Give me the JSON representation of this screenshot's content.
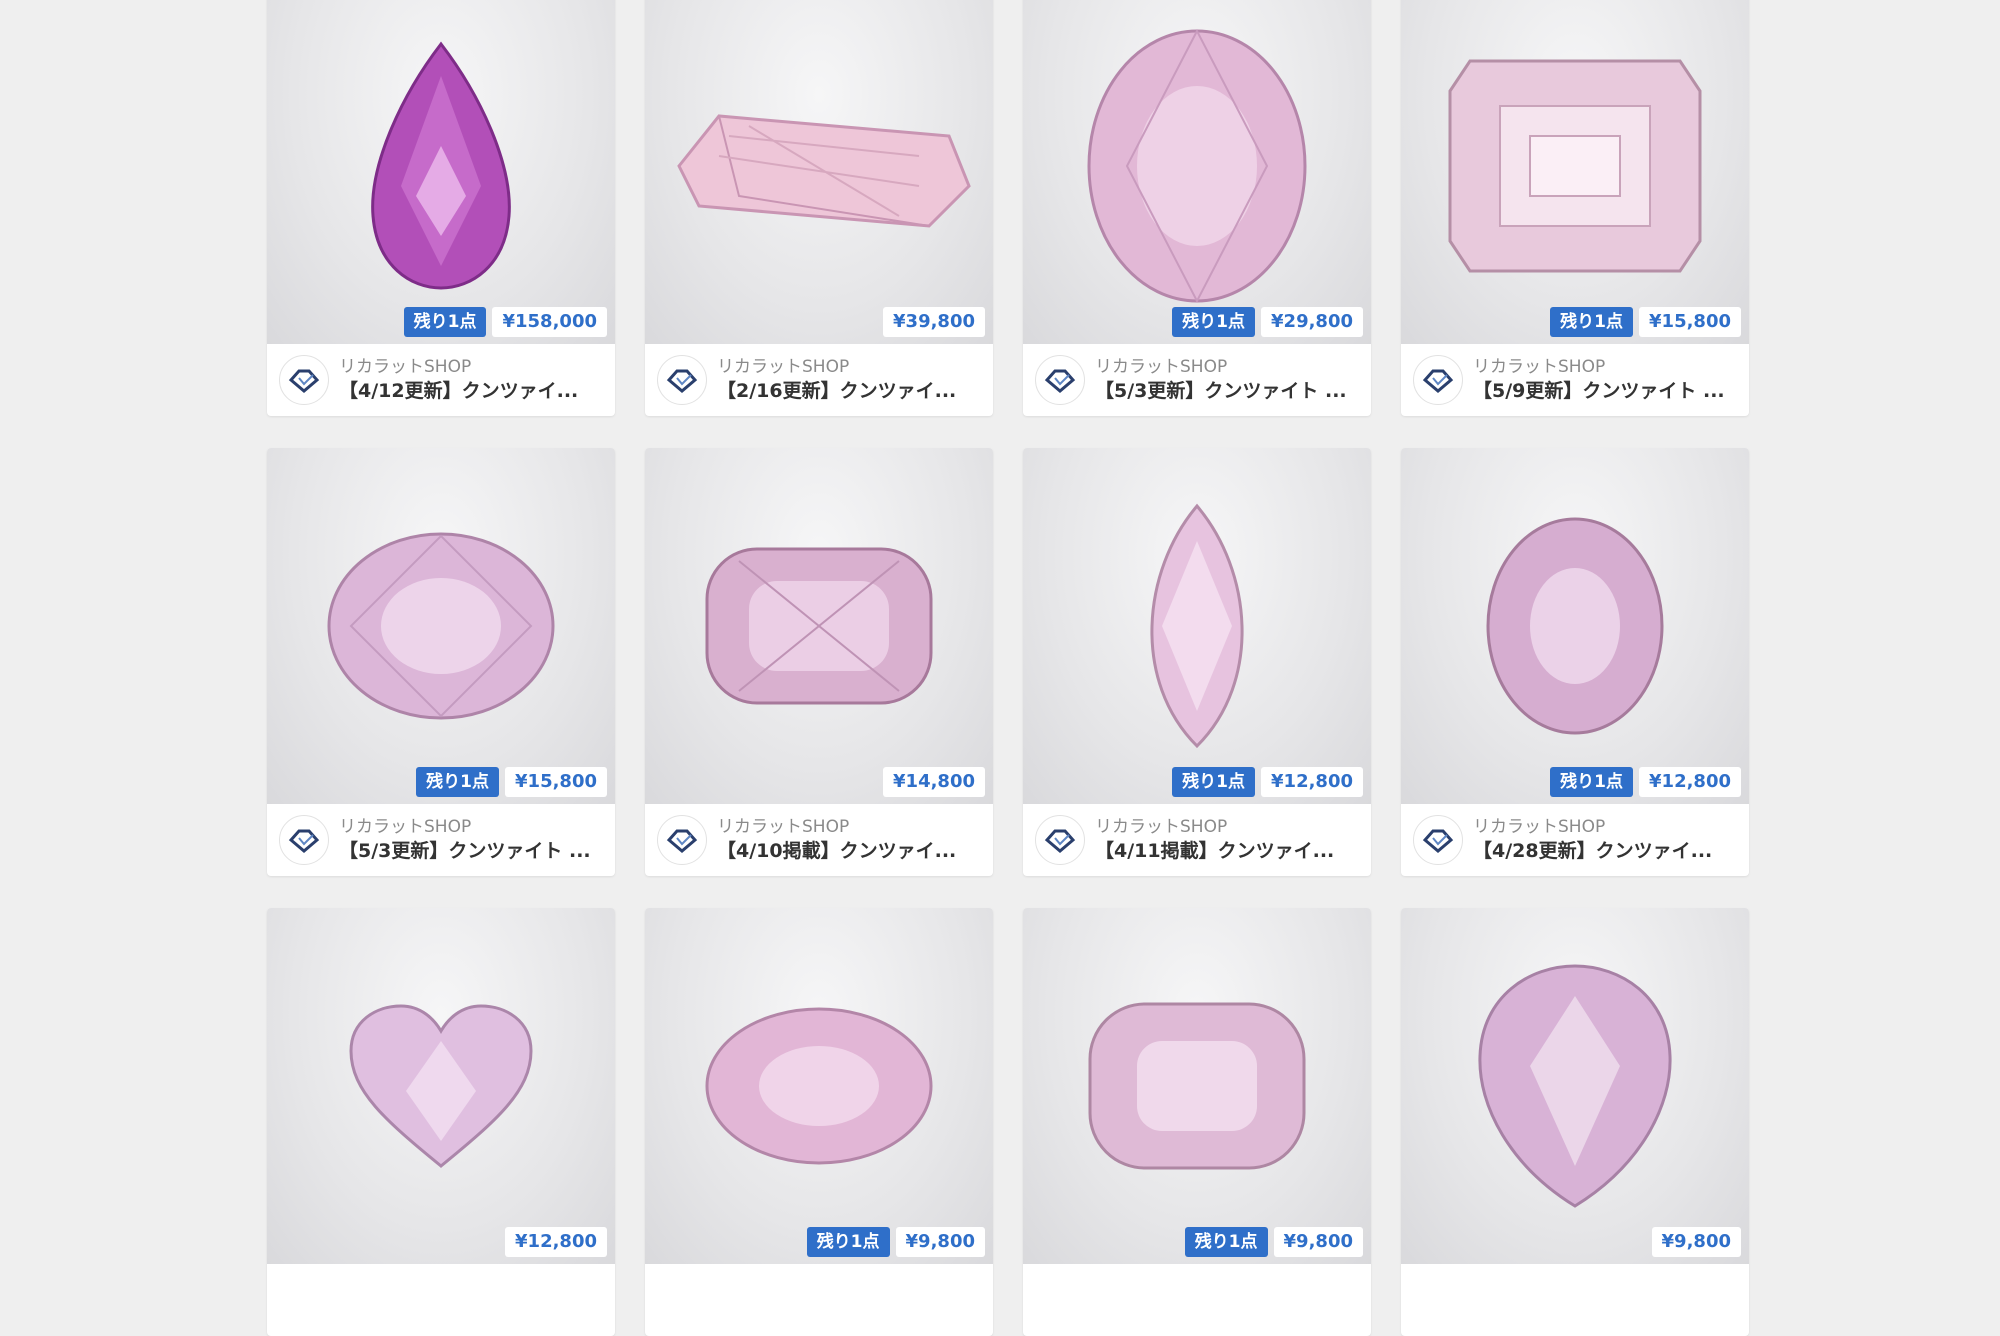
{
  "colors": {
    "accent": "#2f6fc9",
    "background": "#efefef"
  },
  "listings": [
    {
      "shop": "リカラットSHOP",
      "title": "【4/12更新】クンツァイ...",
      "price": "¥158,000",
      "stock": "残り1点",
      "gem": "pear-gem-icon",
      "tone": "#b24fb8"
    },
    {
      "shop": "リカラットSHOP",
      "title": "【2/16更新】クンツァイ...",
      "price": "¥39,800",
      "stock": "",
      "gem": "elongated-gem-icon",
      "tone": "#eec6d8"
    },
    {
      "shop": "リカラットSHOP",
      "title": "【5/3更新】クンツァイト ...",
      "price": "¥29,800",
      "stock": "残り1点",
      "gem": "oval-gem-icon",
      "tone": "#e2b8d6"
    },
    {
      "shop": "リカラットSHOP",
      "title": "【5/9更新】クンツァイト ...",
      "price": "¥15,800",
      "stock": "残り1点",
      "gem": "emerald-cut-gem-icon",
      "tone": "#e8c9dc"
    },
    {
      "shop": "リカラットSHOP",
      "title": "【5/3更新】クンツァイト ...",
      "price": "¥15,800",
      "stock": "残り1点",
      "gem": "oval-gem-icon",
      "tone": "#dcb6d8"
    },
    {
      "shop": "リカラットSHOP",
      "title": "【4/10掲載】クンツァイ...",
      "price": "¥14,800",
      "stock": "",
      "gem": "cushion-gem-icon",
      "tone": "#d9b0cf"
    },
    {
      "shop": "リカラットSHOP",
      "title": "【4/11掲載】クンツァイ...",
      "price": "¥12,800",
      "stock": "残り1点",
      "gem": "marquise-gem-icon",
      "tone": "#e7c3df"
    },
    {
      "shop": "リカラットSHOP",
      "title": "【4/28更新】クンツァイ...",
      "price": "¥12,800",
      "stock": "残り1点",
      "gem": "oval-gem-icon",
      "tone": "#d6add0"
    },
    {
      "shop": "",
      "title": "",
      "price": "¥12,800",
      "stock": "",
      "gem": "heart-gem-icon",
      "tone": "#e0bfe0"
    },
    {
      "shop": "",
      "title": "",
      "price": "¥9,800",
      "stock": "残り1点",
      "gem": "oval-gem-icon",
      "tone": "#e2b6d6"
    },
    {
      "shop": "",
      "title": "",
      "price": "¥9,800",
      "stock": "残り1点",
      "gem": "cushion-gem-icon",
      "tone": "#dfbad6"
    },
    {
      "shop": "",
      "title": "",
      "price": "¥9,800",
      "stock": "",
      "gem": "pear-gem-icon",
      "tone": "#d8b2d6"
    }
  ]
}
